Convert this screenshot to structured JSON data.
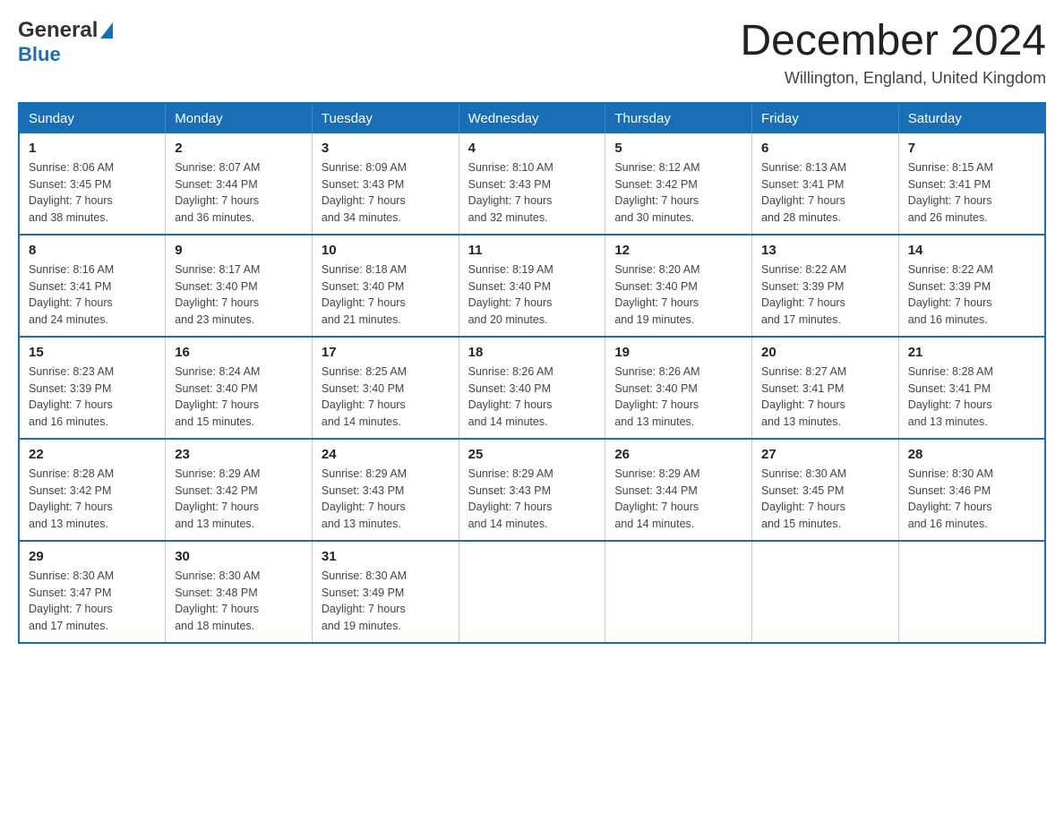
{
  "header": {
    "logo": {
      "line1": "General",
      "line2": "Blue"
    },
    "title": "December 2024",
    "location": "Willington, England, United Kingdom"
  },
  "calendar": {
    "days_of_week": [
      "Sunday",
      "Monday",
      "Tuesday",
      "Wednesday",
      "Thursday",
      "Friday",
      "Saturday"
    ],
    "weeks": [
      [
        {
          "day": "1",
          "sunrise": "Sunrise: 8:06 AM",
          "sunset": "Sunset: 3:45 PM",
          "daylight": "Daylight: 7 hours",
          "daylight2": "and 38 minutes."
        },
        {
          "day": "2",
          "sunrise": "Sunrise: 8:07 AM",
          "sunset": "Sunset: 3:44 PM",
          "daylight": "Daylight: 7 hours",
          "daylight2": "and 36 minutes."
        },
        {
          "day": "3",
          "sunrise": "Sunrise: 8:09 AM",
          "sunset": "Sunset: 3:43 PM",
          "daylight": "Daylight: 7 hours",
          "daylight2": "and 34 minutes."
        },
        {
          "day": "4",
          "sunrise": "Sunrise: 8:10 AM",
          "sunset": "Sunset: 3:43 PM",
          "daylight": "Daylight: 7 hours",
          "daylight2": "and 32 minutes."
        },
        {
          "day": "5",
          "sunrise": "Sunrise: 8:12 AM",
          "sunset": "Sunset: 3:42 PM",
          "daylight": "Daylight: 7 hours",
          "daylight2": "and 30 minutes."
        },
        {
          "day": "6",
          "sunrise": "Sunrise: 8:13 AM",
          "sunset": "Sunset: 3:41 PM",
          "daylight": "Daylight: 7 hours",
          "daylight2": "and 28 minutes."
        },
        {
          "day": "7",
          "sunrise": "Sunrise: 8:15 AM",
          "sunset": "Sunset: 3:41 PM",
          "daylight": "Daylight: 7 hours",
          "daylight2": "and 26 minutes."
        }
      ],
      [
        {
          "day": "8",
          "sunrise": "Sunrise: 8:16 AM",
          "sunset": "Sunset: 3:41 PM",
          "daylight": "Daylight: 7 hours",
          "daylight2": "and 24 minutes."
        },
        {
          "day": "9",
          "sunrise": "Sunrise: 8:17 AM",
          "sunset": "Sunset: 3:40 PM",
          "daylight": "Daylight: 7 hours",
          "daylight2": "and 23 minutes."
        },
        {
          "day": "10",
          "sunrise": "Sunrise: 8:18 AM",
          "sunset": "Sunset: 3:40 PM",
          "daylight": "Daylight: 7 hours",
          "daylight2": "and 21 minutes."
        },
        {
          "day": "11",
          "sunrise": "Sunrise: 8:19 AM",
          "sunset": "Sunset: 3:40 PM",
          "daylight": "Daylight: 7 hours",
          "daylight2": "and 20 minutes."
        },
        {
          "day": "12",
          "sunrise": "Sunrise: 8:20 AM",
          "sunset": "Sunset: 3:40 PM",
          "daylight": "Daylight: 7 hours",
          "daylight2": "and 19 minutes."
        },
        {
          "day": "13",
          "sunrise": "Sunrise: 8:22 AM",
          "sunset": "Sunset: 3:39 PM",
          "daylight": "Daylight: 7 hours",
          "daylight2": "and 17 minutes."
        },
        {
          "day": "14",
          "sunrise": "Sunrise: 8:22 AM",
          "sunset": "Sunset: 3:39 PM",
          "daylight": "Daylight: 7 hours",
          "daylight2": "and 16 minutes."
        }
      ],
      [
        {
          "day": "15",
          "sunrise": "Sunrise: 8:23 AM",
          "sunset": "Sunset: 3:39 PM",
          "daylight": "Daylight: 7 hours",
          "daylight2": "and 16 minutes."
        },
        {
          "day": "16",
          "sunrise": "Sunrise: 8:24 AM",
          "sunset": "Sunset: 3:40 PM",
          "daylight": "Daylight: 7 hours",
          "daylight2": "and 15 minutes."
        },
        {
          "day": "17",
          "sunrise": "Sunrise: 8:25 AM",
          "sunset": "Sunset: 3:40 PM",
          "daylight": "Daylight: 7 hours",
          "daylight2": "and 14 minutes."
        },
        {
          "day": "18",
          "sunrise": "Sunrise: 8:26 AM",
          "sunset": "Sunset: 3:40 PM",
          "daylight": "Daylight: 7 hours",
          "daylight2": "and 14 minutes."
        },
        {
          "day": "19",
          "sunrise": "Sunrise: 8:26 AM",
          "sunset": "Sunset: 3:40 PM",
          "daylight": "Daylight: 7 hours",
          "daylight2": "and 13 minutes."
        },
        {
          "day": "20",
          "sunrise": "Sunrise: 8:27 AM",
          "sunset": "Sunset: 3:41 PM",
          "daylight": "Daylight: 7 hours",
          "daylight2": "and 13 minutes."
        },
        {
          "day": "21",
          "sunrise": "Sunrise: 8:28 AM",
          "sunset": "Sunset: 3:41 PM",
          "daylight": "Daylight: 7 hours",
          "daylight2": "and 13 minutes."
        }
      ],
      [
        {
          "day": "22",
          "sunrise": "Sunrise: 8:28 AM",
          "sunset": "Sunset: 3:42 PM",
          "daylight": "Daylight: 7 hours",
          "daylight2": "and 13 minutes."
        },
        {
          "day": "23",
          "sunrise": "Sunrise: 8:29 AM",
          "sunset": "Sunset: 3:42 PM",
          "daylight": "Daylight: 7 hours",
          "daylight2": "and 13 minutes."
        },
        {
          "day": "24",
          "sunrise": "Sunrise: 8:29 AM",
          "sunset": "Sunset: 3:43 PM",
          "daylight": "Daylight: 7 hours",
          "daylight2": "and 13 minutes."
        },
        {
          "day": "25",
          "sunrise": "Sunrise: 8:29 AM",
          "sunset": "Sunset: 3:43 PM",
          "daylight": "Daylight: 7 hours",
          "daylight2": "and 14 minutes."
        },
        {
          "day": "26",
          "sunrise": "Sunrise: 8:29 AM",
          "sunset": "Sunset: 3:44 PM",
          "daylight": "Daylight: 7 hours",
          "daylight2": "and 14 minutes."
        },
        {
          "day": "27",
          "sunrise": "Sunrise: 8:30 AM",
          "sunset": "Sunset: 3:45 PM",
          "daylight": "Daylight: 7 hours",
          "daylight2": "and 15 minutes."
        },
        {
          "day": "28",
          "sunrise": "Sunrise: 8:30 AM",
          "sunset": "Sunset: 3:46 PM",
          "daylight": "Daylight: 7 hours",
          "daylight2": "and 16 minutes."
        }
      ],
      [
        {
          "day": "29",
          "sunrise": "Sunrise: 8:30 AM",
          "sunset": "Sunset: 3:47 PM",
          "daylight": "Daylight: 7 hours",
          "daylight2": "and 17 minutes."
        },
        {
          "day": "30",
          "sunrise": "Sunrise: 8:30 AM",
          "sunset": "Sunset: 3:48 PM",
          "daylight": "Daylight: 7 hours",
          "daylight2": "and 18 minutes."
        },
        {
          "day": "31",
          "sunrise": "Sunrise: 8:30 AM",
          "sunset": "Sunset: 3:49 PM",
          "daylight": "Daylight: 7 hours",
          "daylight2": "and 19 minutes."
        },
        null,
        null,
        null,
        null
      ]
    ]
  }
}
